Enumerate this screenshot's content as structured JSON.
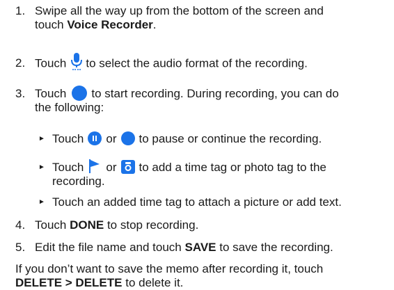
{
  "steps": {
    "s1": {
      "num": "1.",
      "line1": "Swipe all the way up from the bottom of the screen and",
      "line2_pre": "touch ",
      "line2_bold": "Voice Recorder",
      "line2_post": "."
    },
    "s2": {
      "num": "2.",
      "pre": "Touch",
      "post": "to select the audio format of the recording."
    },
    "s3": {
      "num": "3.",
      "pre": "Touch",
      "post": "to start recording. During recording, you can do",
      "line2": "the following:"
    },
    "sub1": {
      "pre": "Touch",
      "mid": "or",
      "post": "to pause or continue the recording."
    },
    "sub2": {
      "pre": "Touch",
      "mid": "or",
      "post": "to add a time tag or photo tag to the",
      "line2": "recording."
    },
    "sub3": {
      "text": "Touch an added time tag to attach a picture or add text."
    },
    "s4": {
      "num": "4.",
      "pre": "Touch ",
      "bold": "DONE",
      "post": " to stop recording."
    },
    "s5": {
      "num": "5.",
      "pre": "Edit the file name and touch ",
      "bold": "SAVE",
      "post": " to save the recording."
    }
  },
  "note": {
    "line1": "If you don’t want to save the memo after recording it, touch",
    "line2_bold": "DELETE > DELETE",
    "line2_post": " to delete it."
  },
  "icons": {
    "mic": "microphone-format-icon",
    "record": "record-icon",
    "pause": "pause-icon",
    "continue": "continue-record-icon",
    "flag": "time-tag-flag-icon",
    "camera": "photo-tag-camera-icon"
  },
  "colors": {
    "accent": "#1b73e8",
    "text": "#1a1a1a",
    "bullet": "#1a1a1a"
  }
}
